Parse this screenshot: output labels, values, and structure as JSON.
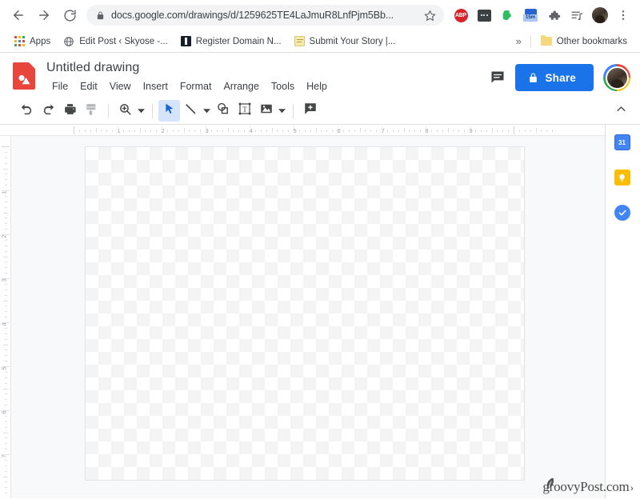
{
  "browser": {
    "nav": {
      "back_label": "Back",
      "forward_label": "Forward",
      "reload_label": "Reload"
    },
    "omnibox": {
      "url": "docs.google.com/drawings/d/1259625TE4LaJmuR8LnfPjm5Bb...",
      "lock_icon": "lock-icon",
      "star_icon": "star-icon"
    },
    "extensions": [
      {
        "name": "adblock-plus-extension",
        "label": "ABP"
      },
      {
        "name": "dots-extension",
        "label": ""
      },
      {
        "name": "evernote-extension",
        "label": ""
      },
      {
        "name": "timer-extension",
        "label": "15m"
      },
      {
        "name": "extensions-puzzle",
        "label": ""
      },
      {
        "name": "media-list",
        "label": ""
      }
    ],
    "menu_icon": "kebab-menu-icon",
    "bookmarks": {
      "apps_label": "Apps",
      "items": [
        {
          "label": "Edit Post ‹ Skyose -...",
          "icon": "globe-favicon"
        },
        {
          "label": "Register Domain N...",
          "icon": "dark-favicon"
        },
        {
          "label": "Submit Your Story |...",
          "icon": "note-favicon"
        }
      ],
      "overflow_label": "»",
      "other_bookmarks_label": "Other bookmarks"
    }
  },
  "app": {
    "title": "Untitled drawing",
    "logo_icon": "google-drawings-logo",
    "menus": [
      "File",
      "Edit",
      "View",
      "Insert",
      "Format",
      "Arrange",
      "Tools",
      "Help"
    ],
    "comment_icon": "comment-icon",
    "share": {
      "label": "Share",
      "icon": "lock-icon",
      "color": "#1a73e8"
    },
    "account_avatar": "user-avatar",
    "toolbar": [
      {
        "name": "undo-button",
        "icon": "undo-icon",
        "state": "normal"
      },
      {
        "name": "redo-button",
        "icon": "redo-icon",
        "state": "normal"
      },
      {
        "name": "print-button",
        "icon": "print-icon",
        "state": "normal"
      },
      {
        "name": "paint-format-button",
        "icon": "paint-format-icon",
        "state": "disabled"
      },
      {
        "name": "zoom-button",
        "icon": "zoom-icon",
        "state": "normal",
        "has_caret": true
      },
      {
        "name": "select-tool",
        "icon": "cursor-arrow-icon",
        "state": "active"
      },
      {
        "name": "line-tool",
        "icon": "line-icon",
        "state": "normal",
        "has_caret": true
      },
      {
        "name": "shape-tool",
        "icon": "shape-icon",
        "state": "normal"
      },
      {
        "name": "text-box-tool",
        "icon": "text-box-icon",
        "state": "normal"
      },
      {
        "name": "image-tool",
        "icon": "image-icon",
        "state": "normal",
        "has_caret": true
      },
      {
        "name": "comment-tool",
        "icon": "add-comment-icon",
        "state": "normal"
      }
    ],
    "collapse_toolbar_icon": "chevron-up-icon",
    "rulers": {
      "horizontal_labels": [
        "1",
        "2",
        "3",
        "4",
        "5",
        "6",
        "7",
        "8",
        "9"
      ],
      "vertical_labels": [
        "1",
        "2",
        "3",
        "4",
        "5",
        "6",
        "7"
      ],
      "units": "inches"
    },
    "canvas": {
      "name": "drawing-canvas",
      "background": "transparent-checkerboard"
    },
    "side_panel": [
      {
        "name": "google-calendar-icon",
        "label": "31",
        "color": "#4285f4"
      },
      {
        "name": "google-keep-icon",
        "label": "",
        "color": "#fbbc04"
      },
      {
        "name": "google-tasks-icon",
        "label": "",
        "color": "#4285f4"
      }
    ]
  },
  "watermark": {
    "text": "groovyPost.com",
    "caret": "›"
  }
}
